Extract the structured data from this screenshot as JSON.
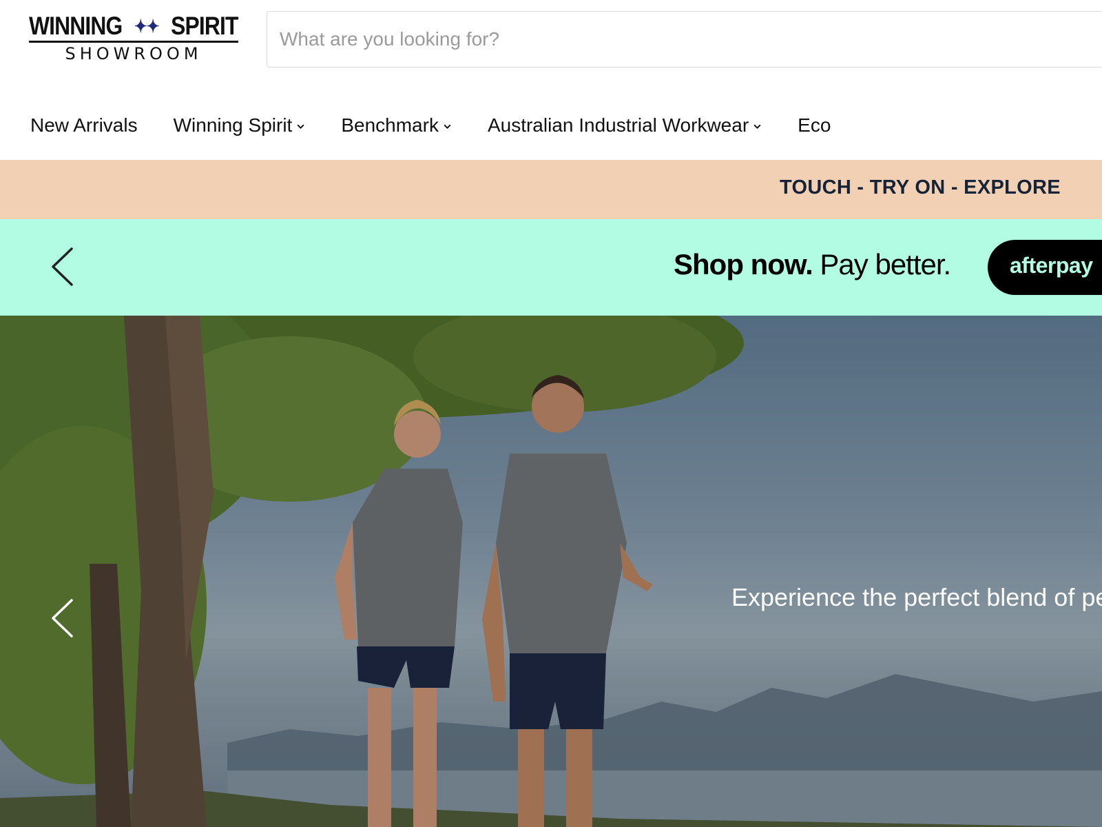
{
  "logo": {
    "top_text_left": "WINNING",
    "top_text_right": "SPIRIT",
    "stars": "✦✦",
    "bottom_text": "SHOWROOM"
  },
  "search": {
    "placeholder": "What are you looking for?",
    "value": ""
  },
  "nav": {
    "items": [
      {
        "label": "New Arrivals",
        "has_dropdown": false
      },
      {
        "label": "Winning Spirit",
        "has_dropdown": true
      },
      {
        "label": "Benchmark",
        "has_dropdown": true
      },
      {
        "label": "Australian Industrial Workwear",
        "has_dropdown": true
      },
      {
        "label": "Eco",
        "has_dropdown": false
      }
    ]
  },
  "promo": {
    "text": "TOUCH - TRY ON - EXPLORE",
    "background": "#f2d0b4",
    "color": "#152238"
  },
  "afterpay_banner": {
    "headline_strong": "Shop now.",
    "headline_rest": " Pay better.",
    "pill_label": "afterpay",
    "background": "#b2fce4",
    "pill_background": "#000000",
    "prev_icon": "chevron-left-icon"
  },
  "hero": {
    "caption": "Experience the perfect blend of perf",
    "prev_icon": "chevron-left-icon"
  },
  "icons": {
    "dropdown": "chevron-down-icon"
  }
}
